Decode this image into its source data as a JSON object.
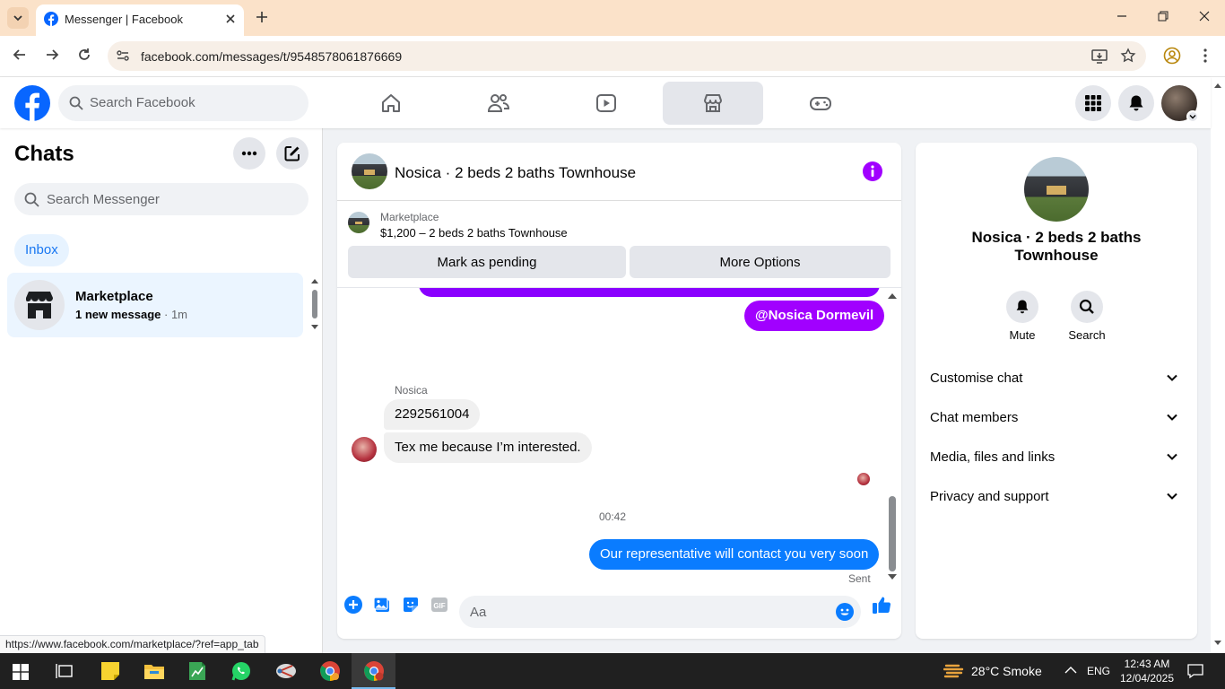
{
  "browser": {
    "tab_title": "Messenger | Facebook",
    "url": "facebook.com/messages/t/9548578061876669",
    "status_link": "https://www.facebook.com/marketplace/?ref=app_tab"
  },
  "fb_nav": {
    "search_placeholder": "Search Facebook",
    "active_tab": "marketplace"
  },
  "chats": {
    "title": "Chats",
    "search_placeholder": "Search Messenger",
    "filter": "Inbox",
    "items": [
      {
        "name": "Marketplace",
        "unread": "1 new message",
        "time": "· 1m"
      }
    ]
  },
  "conversation": {
    "title": "Nosica · 2 beds 2 baths Townhouse",
    "listing": {
      "label": "Marketplace",
      "price_title": "$1,200 – 2 beds 2 baths Townhouse",
      "btn_pending": "Mark as pending",
      "btn_more": "More Options"
    },
    "messages": {
      "mention": "@Nosica Dormevil",
      "sender": "Nosica",
      "msg1": "2292561004",
      "msg2": "Tex me because I’m interested.",
      "time": "00:42",
      "msg3": "Our representative will contact you very soon",
      "status": "Sent"
    },
    "composer_placeholder": "Aa"
  },
  "info_panel": {
    "name": "Nosica · 2 beds 2 baths Townhouse",
    "actions": {
      "mute": "Mute",
      "search": "Search"
    },
    "sections": [
      "Customise chat",
      "Chat members",
      "Media, files and links",
      "Privacy and support"
    ]
  },
  "taskbar": {
    "weather": "28°C  Smoke",
    "lang": "ENG",
    "time": "12:43 AM",
    "date": "12/04/2025"
  },
  "colors": {
    "fb_blue": "#0866ff",
    "messenger_purple": "#a100ff",
    "outgoing_blue": "#0a7cff"
  }
}
